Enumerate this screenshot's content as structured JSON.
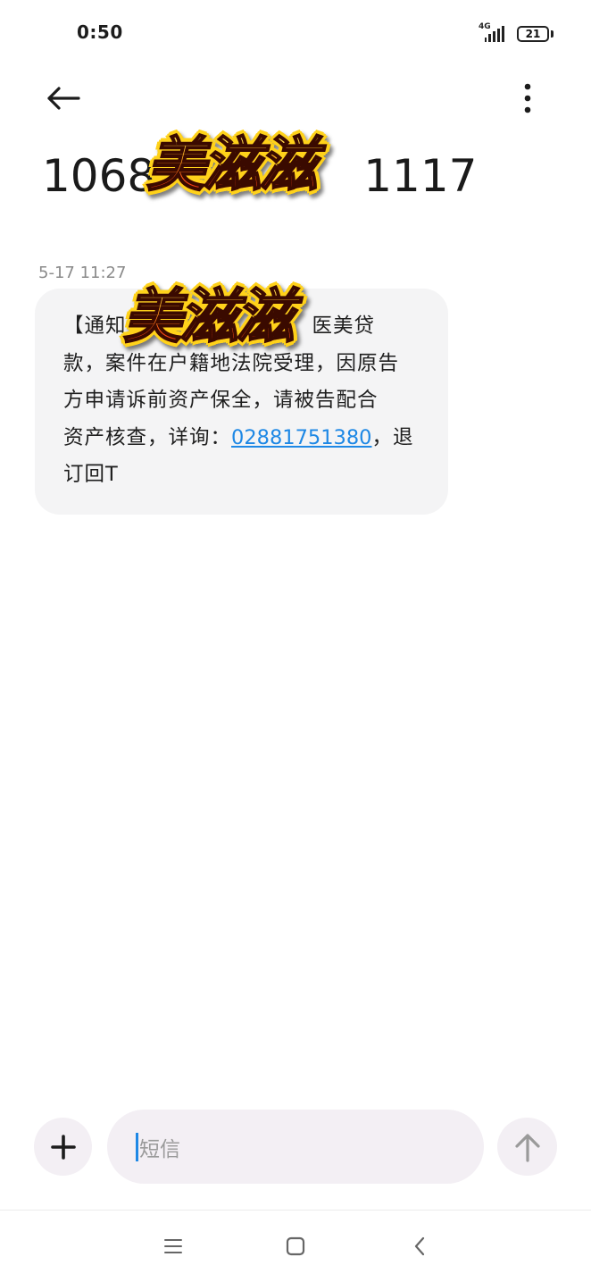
{
  "status_bar": {
    "time": "0:50",
    "network": "4G",
    "battery": "21"
  },
  "header": {
    "title_start": "1068",
    "title_end": "1117",
    "back_icon": "arrow-left-icon",
    "more_icon": "more-vertical-icon"
  },
  "sticker": {
    "text": "美滋滋"
  },
  "message": {
    "timestamp": "5-17 11:27",
    "line1_start": "【通知",
    "line1_end": "医美贷",
    "line2": "款，案件在户籍地法院受理，因原告",
    "line3": "方申请诉前资产保全，请被告配合",
    "line4_prefix": "资产核查，详询：",
    "phone": "02881751380",
    "line4_suffix": "，退",
    "line5": "订回T"
  },
  "compose": {
    "placeholder": "短信",
    "add_icon": "plus-icon",
    "send_icon": "arrow-up-icon"
  },
  "nav": {
    "menu_icon": "menu-icon",
    "home_icon": "square-home-icon",
    "back_icon": "chevron-left-icon"
  },
  "colors": {
    "link": "#1e88e5",
    "bubble": "#f4f4f5",
    "button_bg": "#f3eff4",
    "timestamp": "#8a8a8a"
  }
}
